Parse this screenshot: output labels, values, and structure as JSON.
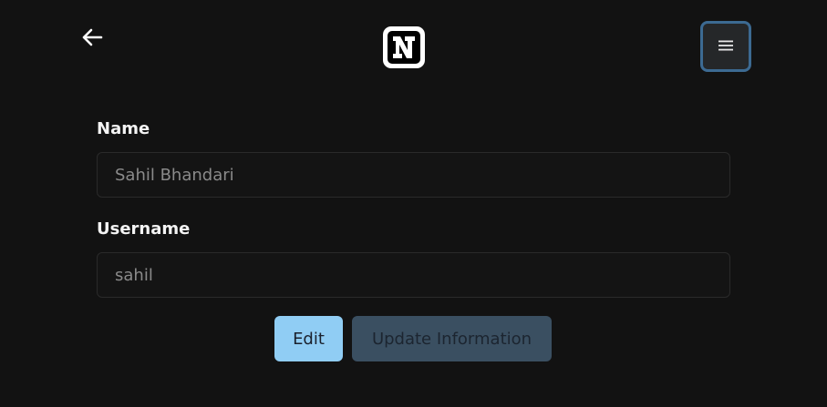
{
  "header": {
    "back_icon": "arrow-left-icon",
    "logo_letter": "N",
    "menu_icon": "hamburger-menu-icon"
  },
  "form": {
    "name_label": "Name",
    "name_value": "Sahil Bhandari",
    "username_label": "Username",
    "username_value": "sahil"
  },
  "actions": {
    "edit_label": "Edit",
    "update_label": "Update Information"
  },
  "colors": {
    "background": "#121212",
    "edit_button": "#90cdf4",
    "update_button": "#3a4f61",
    "menu_border": "#3c6a92"
  }
}
